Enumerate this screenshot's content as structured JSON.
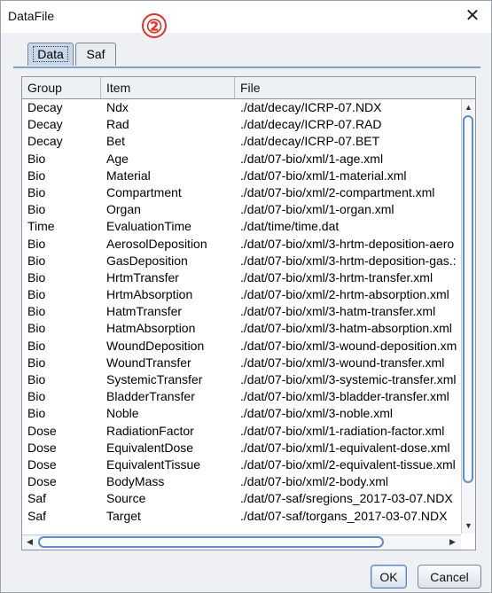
{
  "window": {
    "title": "DataFile",
    "close_glyph": "✕"
  },
  "annotation": "②",
  "tabs": [
    {
      "label": "Data"
    },
    {
      "label": "Saf"
    }
  ],
  "table": {
    "columns": [
      "Group",
      "Item",
      "File"
    ],
    "rows": [
      [
        "Decay",
        "Ndx",
        "./dat/decay/ICRP-07.NDX"
      ],
      [
        "Decay",
        "Rad",
        "./dat/decay/ICRP-07.RAD"
      ],
      [
        "Decay",
        "Bet",
        "./dat/decay/ICRP-07.BET"
      ],
      [
        "Bio",
        "Age",
        "./dat/07-bio/xml/1-age.xml"
      ],
      [
        "Bio",
        "Material",
        "./dat/07-bio/xml/1-material.xml"
      ],
      [
        "Bio",
        "Compartment",
        "./dat/07-bio/xml/2-compartment.xml"
      ],
      [
        "Bio",
        "Organ",
        "./dat/07-bio/xml/1-organ.xml"
      ],
      [
        "Time",
        "EvaluationTime",
        "./dat/time/time.dat"
      ],
      [
        "Bio",
        "AerosolDeposition",
        "./dat/07-bio/xml/3-hrtm-deposition-aero"
      ],
      [
        "Bio",
        "GasDeposition",
        "./dat/07-bio/xml/3-hrtm-deposition-gas.:"
      ],
      [
        "Bio",
        "HrtmTransfer",
        "./dat/07-bio/xml/3-hrtm-transfer.xml"
      ],
      [
        "Bio",
        "HrtmAbsorption",
        "./dat/07-bio/xml/2-hrtm-absorption.xml"
      ],
      [
        "Bio",
        "HatmTransfer",
        "./dat/07-bio/xml/3-hatm-transfer.xml"
      ],
      [
        "Bio",
        "HatmAbsorption",
        "./dat/07-bio/xml/3-hatm-absorption.xml"
      ],
      [
        "Bio",
        "WoundDeposition",
        "./dat/07-bio/xml/3-wound-deposition.xm"
      ],
      [
        "Bio",
        "WoundTransfer",
        "./dat/07-bio/xml/3-wound-transfer.xml"
      ],
      [
        "Bio",
        "SystemicTransfer",
        "./dat/07-bio/xml/3-systemic-transfer.xml"
      ],
      [
        "Bio",
        "BladderTransfer",
        "./dat/07-bio/xml/3-bladder-transfer.xml"
      ],
      [
        "Bio",
        "Noble",
        "./dat/07-bio/xml/3-noble.xml"
      ],
      [
        "Dose",
        "RadiationFactor",
        "./dat/07-bio/xml/1-radiation-factor.xml"
      ],
      [
        "Dose",
        "EquivalentDose",
        "./dat/07-bio/xml/1-equivalent-dose.xml"
      ],
      [
        "Dose",
        "EquivalentTissue",
        "./dat/07-bio/xml/2-equivalent-tissue.xml"
      ],
      [
        "Dose",
        "BodyMass",
        "./dat/07-bio/xml/2-body.xml"
      ],
      [
        "Saf",
        "Source",
        "./dat/07-saf/sregions_2017-03-07.NDX"
      ],
      [
        "Saf",
        "Target",
        "./dat/07-saf/torgans_2017-03-07.NDX"
      ]
    ]
  },
  "buttons": {
    "ok": "OK",
    "cancel": "Cancel"
  }
}
